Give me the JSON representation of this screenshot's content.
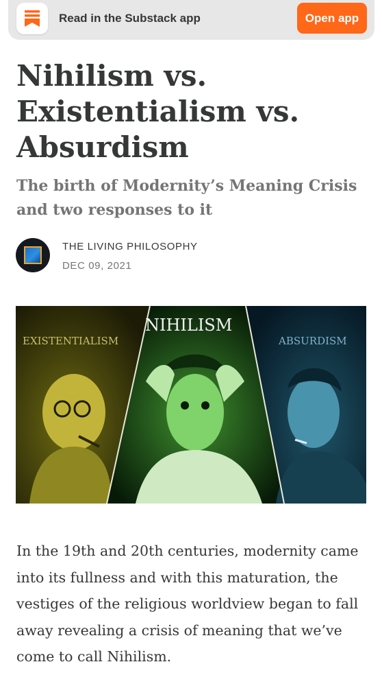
{
  "app_banner": {
    "text": "Read in the Substack app",
    "button_label": "Open app",
    "icon": "substack-logo-icon",
    "accent_color": "#ff6719"
  },
  "post": {
    "title": "Nihilism vs. Existentialism vs. Absurdism",
    "subtitle": "The birth of Modernity’s Meaning Crisis and two responses to it",
    "publication": "THE LIVING PHILOSOPHY",
    "date": "DEC 09, 2021",
    "body": "In the 19th and 20th centuries, modernity came into its fullness and with this maturation, the vestiges of the religious worldview began to fall away revealing a crisis of meaning that we’ve come to call Nihilism."
  },
  "hero_image": {
    "left_label": "EXISTENTIALISM",
    "center_label": "NIHILISM",
    "right_label": "ABSURDISM",
    "left_tint": "#b9b227",
    "center_tint": "#3a9a2c",
    "right_tint": "#2a6f86"
  }
}
